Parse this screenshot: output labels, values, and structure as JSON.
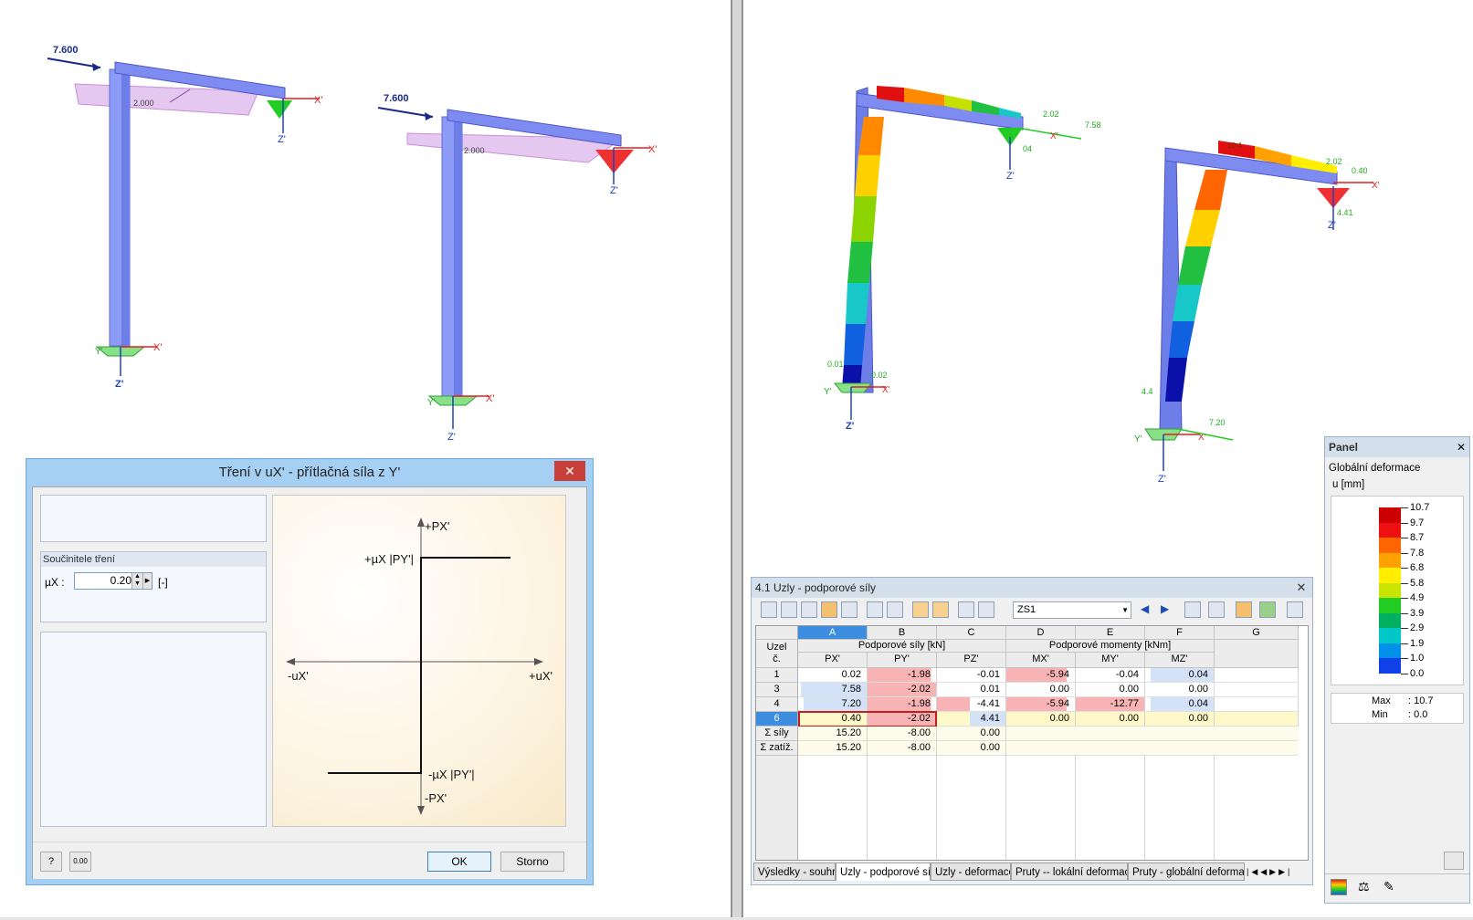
{
  "left_view": {
    "load1": "7.600",
    "load2": "7.600",
    "dim1": "2.000",
    "dim2": "2.000",
    "axes": {
      "x": "X'",
      "y": "Y'",
      "z": "Z'"
    }
  },
  "right_view": {
    "v_2_02_a": "2.02",
    "v_7_58": "7.58",
    "v_04": "04",
    "v_0_01": "0.01",
    "v_0_02": "0.02",
    "v_10_4": "10.4",
    "v_2_02_b": "2.02",
    "v_0_40": "0.40",
    "v_4_41_a": "4.41",
    "v_4_41_b": "4.4",
    "v_7_20": "7.20",
    "axes": {
      "x": "X'",
      "y": "Y'",
      "z": "Z'"
    }
  },
  "dialog": {
    "title": "Tření v uX' - přítlačná síla z Y'",
    "close": "✕",
    "section_label": "Součinitele tření",
    "mu_label": "µX :",
    "mu_value": "0.20",
    "unit": "[-]",
    "ok": "OK",
    "cancel": "Storno",
    "graph": {
      "plus_p": "+PX'",
      "minus_p": "-PX'",
      "plus_u": "+uX'",
      "minus_u": "-uX'",
      "plus_mu": "+µX |PY'|",
      "minus_mu": "-µX |PY'|"
    }
  },
  "table_window": {
    "title": "4.1 Uzly - podporové síly",
    "close": "✕",
    "load_case": "ZS1",
    "col_letters": [
      "A",
      "B",
      "C",
      "D",
      "E",
      "F",
      "G"
    ],
    "node_header_1": "Uzel",
    "node_header_2": "č.",
    "group_forces": "Podporové síly [kN]",
    "group_moments": "Podporové momenty [kNm]",
    "col_names": [
      "PX'",
      "PY'",
      "PZ'",
      "MX'",
      "MY'",
      "MZ'"
    ],
    "rows": [
      {
        "node": "1",
        "px": "0.02",
        "py": "-1.98",
        "pz": "-0.01",
        "mx": "-5.94",
        "my": "-0.04",
        "mz": "0.04"
      },
      {
        "node": "3",
        "px": "7.58",
        "py": "-2.02",
        "pz": "0.01",
        "mx": "0.00",
        "my": "0.00",
        "mz": "0.00"
      },
      {
        "node": "4",
        "px": "7.20",
        "py": "-1.98",
        "pz": "-4.41",
        "mx": "-5.94",
        "my": "-12.77",
        "mz": "0.04"
      },
      {
        "node": "6",
        "px": "0.40",
        "py": "-2.02",
        "pz": "4.41",
        "mx": "0.00",
        "my": "0.00",
        "mz": "0.00"
      }
    ],
    "sum_forces": {
      "label": "Σ síly",
      "px": "15.20",
      "py": "-8.00",
      "pz": "0.00"
    },
    "sum_loads": {
      "label": "Σ zatíž.",
      "px": "15.20",
      "py": "-8.00",
      "pz": "0.00"
    },
    "tabs": [
      "Výsledky - souhrn",
      "Uzly - podporové síly",
      "Uzly - deformace",
      "Pruty -- lokální deformace",
      "Pruty - globální deformace"
    ]
  },
  "panel": {
    "title": "Panel",
    "close": "✕",
    "subtitle": "Globální deformace",
    "unit": "u [mm]",
    "legend_values": [
      "10.7",
      "9.7",
      "8.7",
      "7.8",
      "6.8",
      "5.8",
      "4.9",
      "3.9",
      "2.9",
      "1.9",
      "1.0",
      "0.0"
    ],
    "legend_colors": [
      "#cc0000",
      "#ee1010",
      "#ff6600",
      "#ffa200",
      "#ffee00",
      "#c8e400",
      "#22cc22",
      "#00b060",
      "#00c8c8",
      "#0090e8",
      "#1040e8",
      "#0000a0"
    ],
    "max_label": "Max",
    "max_value": ": 10.7",
    "min_label": "Min",
    "min_value": ": 0.0"
  }
}
